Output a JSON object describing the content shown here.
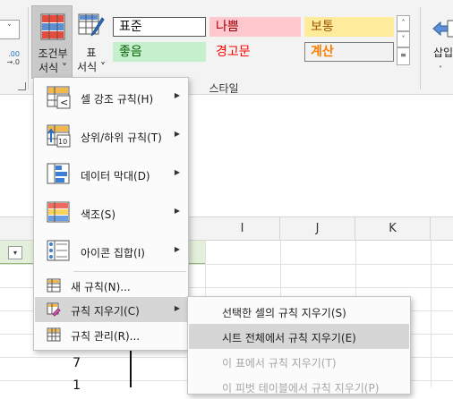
{
  "ribbon": {
    "number_format_value": "",
    "conditional_format": {
      "line1": "조건부",
      "line2": "서식 ˅"
    },
    "format_as_table": {
      "line1": "표",
      "line2": "서식 ˅"
    },
    "styles": {
      "normal": "표준",
      "bad": "나쁨",
      "neutral": "보통",
      "good": "좋음",
      "warning": "경고문",
      "calculation": "계산"
    },
    "styles_group_label": "스타일",
    "insert": {
      "line1": "삽입",
      "line2": "˅"
    }
  },
  "menu": {
    "items": [
      {
        "label": "셀 강조 규칙(H)"
      },
      {
        "label": "상위/하위 규칙(T)"
      },
      {
        "label": "데이터 막대(D)"
      },
      {
        "label": "색조(S)"
      },
      {
        "label": "아이콘 집합(I)"
      },
      {
        "label": "새 규칙(N)..."
      },
      {
        "label": "규칙 지우기(C)"
      },
      {
        "label": "규칙 관리(R)..."
      }
    ],
    "highlighted": "규칙 지우기(C)"
  },
  "submenu": {
    "items": [
      {
        "label": "선택한 셀의 규칙 지우기(S)",
        "enabled": true
      },
      {
        "label": "시트 전체에서 규칙 지우기(E)",
        "enabled": true
      },
      {
        "label": "이 표에서 규칙 지우기(T)",
        "enabled": false
      },
      {
        "label": "이 피벗 테이블에서 규칙 지우기(P)",
        "enabled": false
      }
    ],
    "highlighted": "시트 전체에서 규칙 지우기(E)"
  },
  "sheet": {
    "columns": [
      "I",
      "J",
      "K"
    ],
    "cells": [
      "7",
      "1"
    ]
  }
}
